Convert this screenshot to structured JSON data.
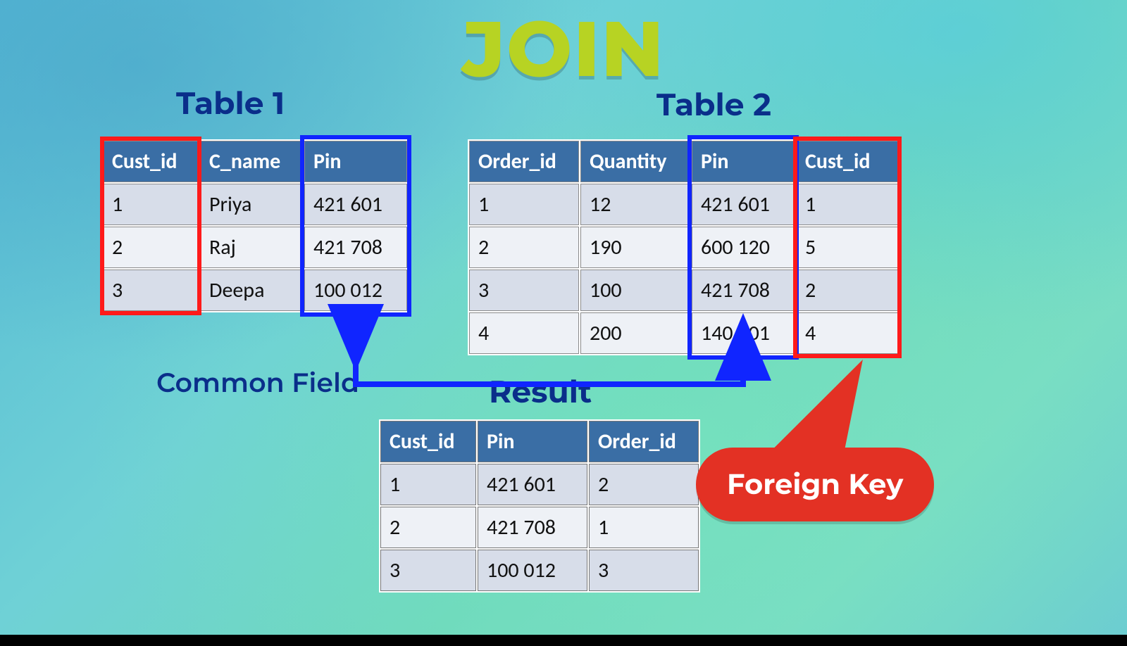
{
  "title": "JOIN",
  "labels": {
    "table1": "Table 1",
    "table2": "Table 2",
    "result": "Result",
    "common_field": "Common Field",
    "foreign_key": "Foreign Key"
  },
  "table1": {
    "headers": [
      "Cust_id",
      "C_name",
      "Pin"
    ],
    "rows": [
      [
        "1",
        "Priya",
        "421 601"
      ],
      [
        "2",
        "Raj",
        "421 708"
      ],
      [
        "3",
        "Deepa",
        "100 012"
      ]
    ]
  },
  "table2": {
    "headers": [
      "Order_id",
      "Quantity",
      "Pin",
      "Cust_id"
    ],
    "rows": [
      [
        "1",
        "12",
        "421 601",
        "1"
      ],
      [
        "2",
        "190",
        "600 120",
        "5"
      ],
      [
        "3",
        "100",
        "421 708",
        "2"
      ],
      [
        "4",
        "200",
        "140 101",
        "4"
      ]
    ]
  },
  "result": {
    "headers": [
      "Cust_id",
      "Pin",
      "Order_id"
    ],
    "rows": [
      [
        "1",
        "421 601",
        "2"
      ],
      [
        "2",
        "421 708",
        "1"
      ],
      [
        "3",
        "100 012",
        "3"
      ]
    ]
  },
  "colors": {
    "accent_title": "#b7d323",
    "label_blue": "#0a2e8a",
    "highlight_red": "#ff1a1a",
    "highlight_blue": "#1025ff",
    "pill_red": "#e33124",
    "table_header": "#3a6ea5"
  }
}
